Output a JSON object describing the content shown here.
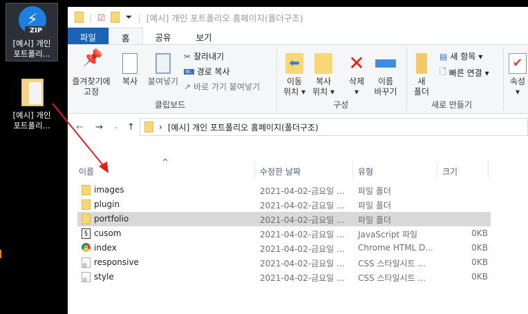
{
  "desktop": [
    {
      "label_line1": "[예시] 개인",
      "label_line2": "포트폴리...",
      "badge": "ZIP",
      "icon": "zip-archive-icon"
    },
    {
      "label_line1": "[예시] 개인",
      "label_line2": "포트폴리...",
      "icon": "folder-icon"
    }
  ],
  "title": "[예시] 개인 포트폴리오 홈페이지(폴더구조)",
  "tabs": [
    "파일",
    "홈",
    "공유",
    "보기"
  ],
  "ribbon": {
    "pin": "즐겨찾기에",
    "pin2": "고정",
    "copy": "복사",
    "paste": "붙여넣기",
    "cut": "잘라내기",
    "copy_path": "경로 복사",
    "paste_shortcut": "바로 가기 붙여넣기",
    "clipboard": "클립보드",
    "move1": "이동",
    "move2": "위치",
    "copyto1": "복사",
    "copyto2": "위치",
    "delete": "삭제",
    "rename1": "이름",
    "rename2": "바꾸기",
    "organize": "구성",
    "newfolder1": "새",
    "newfolder2": "폴더",
    "new_item": "새 항목",
    "easy_access": "빠른 연결",
    "new": "새로 만들기",
    "properties": "속성"
  },
  "address": {
    "path": "[예시] 개인 포트폴리오 홈페이지(폴더구조)"
  },
  "columns": {
    "name": "이름",
    "date": "수정한 날짜",
    "type": "유형",
    "size": "크기"
  },
  "files": [
    {
      "name": "images",
      "date": "2021-04-02-금요일 ...",
      "type": "파일 폴더",
      "size": "",
      "kind": "folder"
    },
    {
      "name": "plugin",
      "date": "2021-04-02-금요일 ...",
      "type": "파일 폴더",
      "size": "",
      "kind": "folder"
    },
    {
      "name": "portfolio",
      "date": "2021-04-02-금요일 ...",
      "type": "파일 폴더",
      "size": "",
      "kind": "folder",
      "selected": true
    },
    {
      "name": "cusom",
      "date": "2021-04-02-금요일 ...",
      "type": "JavaScript 파일",
      "size": "0KB",
      "kind": "js"
    },
    {
      "name": "index",
      "date": "2021-04-02-금요일 ...",
      "type": "Chrome HTML D...",
      "size": "0KB",
      "kind": "chrome"
    },
    {
      "name": "responsive",
      "date": "2021-04-02-금요일 ...",
      "type": "CSS 스타일시트 ...",
      "size": "0KB",
      "kind": "css"
    },
    {
      "name": "style",
      "date": "2021-04-02-금요일 ...",
      "type": "CSS 스타일시트 ...",
      "size": "0KB",
      "kind": "css"
    }
  ]
}
